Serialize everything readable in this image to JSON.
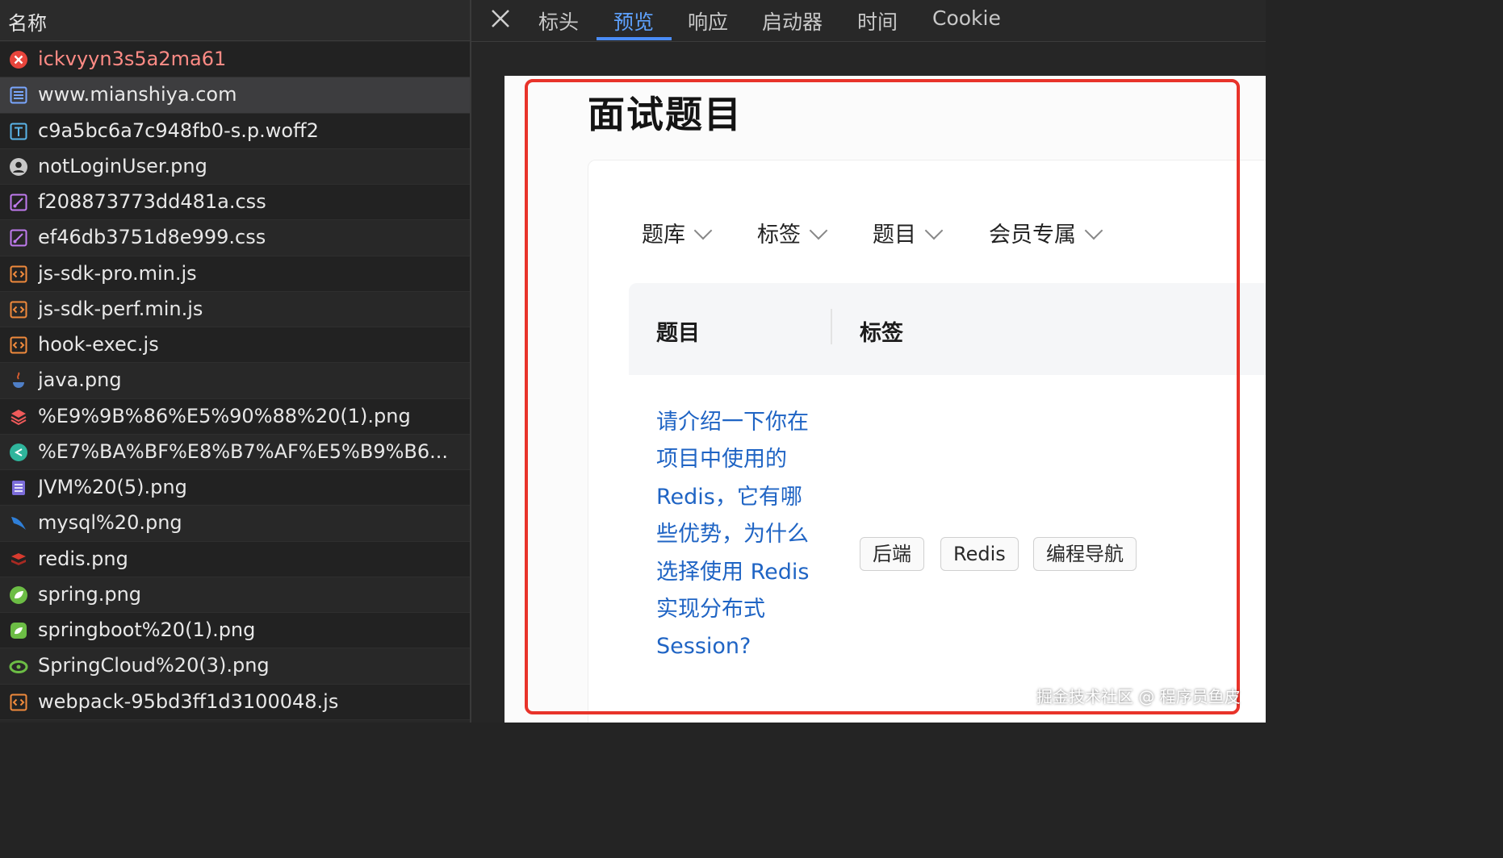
{
  "list": {
    "header": "名称",
    "rows": [
      {
        "name": "ickvyyn3s5a2ma61",
        "icon": "error-icon",
        "color": "#e8453c",
        "status": "error"
      },
      {
        "name": "www.mianshiya.com",
        "icon": "document-icon",
        "color": "#7aa7ff",
        "selected": true
      },
      {
        "name": "c9a5bc6a7c948fb0-s.p.woff2",
        "icon": "font-icon",
        "color": "#5ab4e8"
      },
      {
        "name": "notLoginUser.png",
        "icon": "user-image-icon",
        "color": "#c8c8c8"
      },
      {
        "name": "f208873773dd481a.css",
        "icon": "stylesheet-icon",
        "color": "#c07bef"
      },
      {
        "name": "ef46db3751d8e999.css",
        "icon": "stylesheet-icon",
        "color": "#c07bef"
      },
      {
        "name": "js-sdk-pro.min.js",
        "icon": "script-icon",
        "color": "#f08a3c"
      },
      {
        "name": "js-sdk-perf.min.js",
        "icon": "script-icon",
        "color": "#f08a3c"
      },
      {
        "name": "hook-exec.js",
        "icon": "script-icon",
        "color": "#f08a3c"
      },
      {
        "name": "java.png",
        "icon": "java-icon",
        "color": "#e0602f"
      },
      {
        "name": "%E9%9B%86%E5%90%88%20(1).png",
        "icon": "layers-icon",
        "color": "#f05a5a"
      },
      {
        "name": "%E7%BA%BF%E8%B7%AF%E5%B9%B6...",
        "icon": "route-icon",
        "color": "#2fb59c"
      },
      {
        "name": "JVM%20(5).png",
        "icon": "jvm-icon",
        "color": "#7b6cd9"
      },
      {
        "name": "mysql%20.png",
        "icon": "mysql-icon",
        "color": "#2f7fd8"
      },
      {
        "name": "redis.png",
        "icon": "redis-icon",
        "color": "#d83b2f"
      },
      {
        "name": "spring.png",
        "icon": "spring-icon",
        "color": "#6cbd45"
      },
      {
        "name": "springboot%20(1).png",
        "icon": "springboot-icon",
        "color": "#6cbd45"
      },
      {
        "name": "SpringCloud%20(3).png",
        "icon": "springcloud-icon",
        "color": "#6cbd45"
      },
      {
        "name": "webpack-95bd3ff1d3100048.js",
        "icon": "script-icon",
        "color": "#f08a3c"
      }
    ]
  },
  "tabs": [
    {
      "label": "标头"
    },
    {
      "label": "预览",
      "active": true
    },
    {
      "label": "响应"
    },
    {
      "label": "启动器"
    },
    {
      "label": "时间"
    },
    {
      "label": "Cookie"
    }
  ],
  "preview": {
    "title": "面试题目",
    "filters": [
      "题库",
      "标签",
      "题目",
      "会员专属"
    ],
    "columns": [
      "题目",
      "标签"
    ],
    "question": "请介绍一下你在项目中使用的 Redis，它有哪些优势，为什么选择使用 Redis 实现分布式 Session?",
    "tags": [
      "后端",
      "Redis",
      "编程导航"
    ]
  },
  "watermark": "掘金技术社区 @ 程序员鱼皮",
  "colors": {
    "accent": "#4a8cf7",
    "highlight": "#e8332a",
    "link": "#1f64c4"
  }
}
